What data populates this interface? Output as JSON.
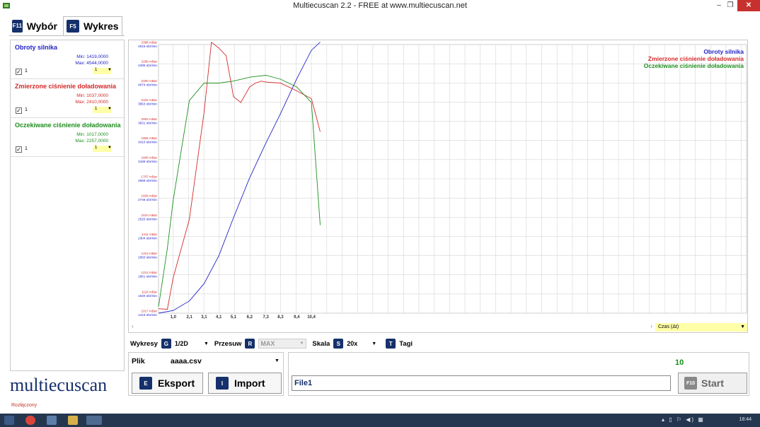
{
  "window": {
    "title": "Multiecuscan 2.2 - FREE at www.multiecuscan.net",
    "min_label": "–",
    "max_label": "❐",
    "close_label": "✕"
  },
  "tabs": [
    {
      "key": "F11",
      "label": "Wybór"
    },
    {
      "key": "F5",
      "label": "Wykres"
    }
  ],
  "signals": [
    {
      "name": "Obroty silnika",
      "min": "Min: 1419,0000",
      "max": "Max: 4544,0000",
      "scale": "1",
      "checked": "✓",
      "color": "#2323c8"
    },
    {
      "name": "Zmierzone ciśnienie doładowania",
      "min": "Min: 1037,0000",
      "max": "Max: 2410,0000",
      "scale": "1",
      "checked": "✓",
      "color": "#d42a2a"
    },
    {
      "name": "Oczekiwane ciśnienie doładowania",
      "min": "Min: 1017,0000",
      "max": "Max: 2257,0000",
      "scale": "1",
      "checked": "✓",
      "color": "#1f8f1f"
    }
  ],
  "chart_data": {
    "type": "line",
    "x_ticks": [
      "1,0",
      "2,1",
      "3,1",
      "4,1",
      "5,1",
      "6,2",
      "7,3",
      "8,3",
      "9,4",
      "10,4"
    ],
    "x_tick_values": [
      1.0,
      2.1,
      3.1,
      4.1,
      5.1,
      6.2,
      7.3,
      8.3,
      9.4,
      10.4
    ],
    "xlim": [
      0,
      40
    ],
    "y_left_ticks_mbar": [
      "1017 mBar",
      "1116 mBar",
      "1214 mBar",
      "1313 mBar",
      "1411 mBar",
      "1510 mBar",
      "1609 mBar",
      "1707 mBar",
      "1806 mBar",
      "1905 mBar",
      "2003 mBar",
      "2102 mBar",
      "2200 mBar",
      "2299 mBar",
      "2398 mBar"
    ],
    "y_left_ticks_rpm": [
      "1419 obr/min",
      "1640 obr/min",
      "1861 obr/min",
      "2083 obr/min",
      "2304 obr/min",
      "2525 obr/min",
      "2746 obr/min",
      "2968 obr/min",
      "3189 obr/min",
      "3410 obr/min",
      "3631 obr/min",
      "3853 obr/min",
      "4074 obr/min",
      "4295 obr/min",
      "4516 obr/min"
    ],
    "ylim_mbar": [
      1017,
      2398
    ],
    "ylim_rpm": [
      1419,
      4516
    ],
    "x_axis_select": "Czas (Δt)",
    "legend": [
      "Obroty silnika",
      "Zmierzone ciśnienie doładowania",
      "Oczekiwane ciśnienie doładowania"
    ],
    "legend_position": "top-right",
    "grid": true,
    "series": [
      {
        "name": "Obroty silnika",
        "axis": "rpm",
        "color": "#2323c8",
        "x": [
          0,
          1.0,
          2.1,
          3.1,
          4.1,
          5.1,
          6.2,
          7.3,
          8.3,
          9.4,
          10.4,
          11.0
        ],
        "values": [
          1419,
          1450,
          1560,
          1760,
          2080,
          2520,
          2980,
          3380,
          3720,
          4120,
          4450,
          4544
        ]
      },
      {
        "name": "Zmierzone ciśnienie doładowania",
        "axis": "mbar",
        "color": "#d42a2a",
        "x": [
          0,
          0.6,
          1.0,
          2.1,
          3.1,
          3.6,
          4.1,
          4.6,
          5.1,
          5.6,
          6.2,
          6.6,
          7.0,
          7.3,
          8.3,
          9.4,
          10.4,
          11.0
        ],
        "values": [
          1040,
          1037,
          1200,
          1500,
          2050,
          2410,
          2380,
          2340,
          2130,
          2100,
          2180,
          2200,
          2210,
          2205,
          2200,
          2160,
          2120,
          1950
        ]
      },
      {
        "name": "Oczekiwane ciśnienie doładowania",
        "axis": "mbar",
        "color": "#1f8f1f",
        "x": [
          0,
          0.6,
          1.0,
          2.1,
          3.1,
          4.1,
          5.1,
          6.2,
          7.3,
          8.3,
          9.4,
          10.4,
          11.0
        ],
        "values": [
          1050,
          1350,
          1600,
          2110,
          2200,
          2200,
          2210,
          2230,
          2240,
          2220,
          2180,
          2100,
          1470
        ]
      }
    ]
  },
  "toolbar": {
    "wykresy_label": "Wykresy",
    "wykresy_key": "G",
    "wykresy_value": "1/2D",
    "przesuw_label": "Przesuw",
    "przesuw_key": "R",
    "przesuw_value": "MAX",
    "skala_label": "Skala",
    "skala_key": "S",
    "skala_value": "20x",
    "tagi_key": "T",
    "tagi_label": "Tagi"
  },
  "file": {
    "label": "Plik",
    "name": "aaaa.csv"
  },
  "buttons": {
    "eksport_key": "E",
    "eksport_label": "Eksport",
    "import_key": "I",
    "import_label": "Import",
    "start_key": "F10",
    "start_label": "Start"
  },
  "counter": "10",
  "file1_value": "File1",
  "logo_text": "multiecuscan",
  "status_text": "Rozłączony",
  "taskbar_clock": "18:44",
  "colors": {
    "accent": "#15306b",
    "highlight": "#ffffa8",
    "taskbar": "#25374f",
    "close": "#c7312d"
  }
}
